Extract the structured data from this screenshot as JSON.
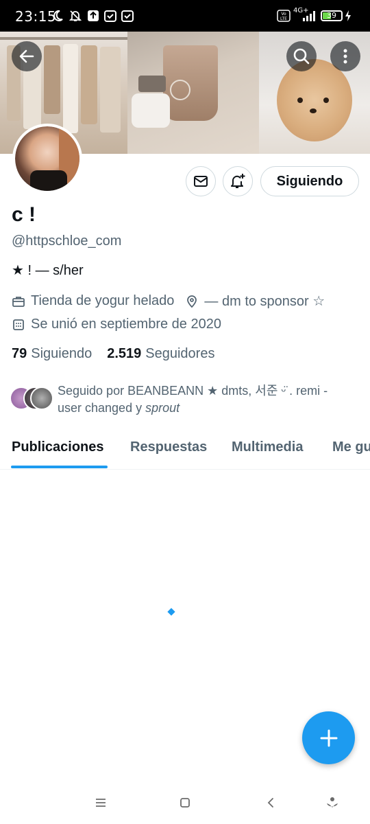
{
  "status_bar": {
    "time": "23:15",
    "network": "4G+",
    "battery": "39",
    "icons": [
      "moon-icon",
      "bell-off-icon",
      "upload-icon",
      "calendar-icon",
      "calendar-icon",
      "volte-icon",
      "signal-icon",
      "battery-icon",
      "charging-icon"
    ]
  },
  "header": {
    "back_icon": "arrow-left-icon",
    "search_icon": "search-icon",
    "more_icon": "more-vertical-icon"
  },
  "profile": {
    "name": "c !",
    "handle": "@httpschloe_com",
    "bio": "★ ! — s/her",
    "profession": "Tienda de yogur helado",
    "location": "— dm to sponsor ☆",
    "joined": "Se unió en septiembre de 2020",
    "following_count": "79",
    "following_label": "Siguiendo",
    "followers_count": "2.519",
    "followers_label": "Seguidores",
    "followed_by_prefix": "Seguido por BEANBEANN ★ dmts, 서준 ᵕ̈ . remi - user changed y ",
    "followed_by_last": "sprout"
  },
  "actions": {
    "message_icon": "mail-icon",
    "notify_icon": "bell-plus-icon",
    "follow_label": "Siguiendo"
  },
  "tabs": [
    {
      "label": "Publicaciones",
      "active": true
    },
    {
      "label": "Respuestas",
      "active": false
    },
    {
      "label": "Multimedia",
      "active": false
    },
    {
      "label": "Me gusta",
      "active": false
    }
  ],
  "fab_icon": "plus-icon",
  "nav_bar": [
    "menu-icon",
    "home-square-icon",
    "back-chevron-icon",
    "assistant-icon"
  ],
  "colors": {
    "accent": "#1d9bf0",
    "text": "#0f1419",
    "secondary": "#536471",
    "border": "#cfd9de"
  }
}
